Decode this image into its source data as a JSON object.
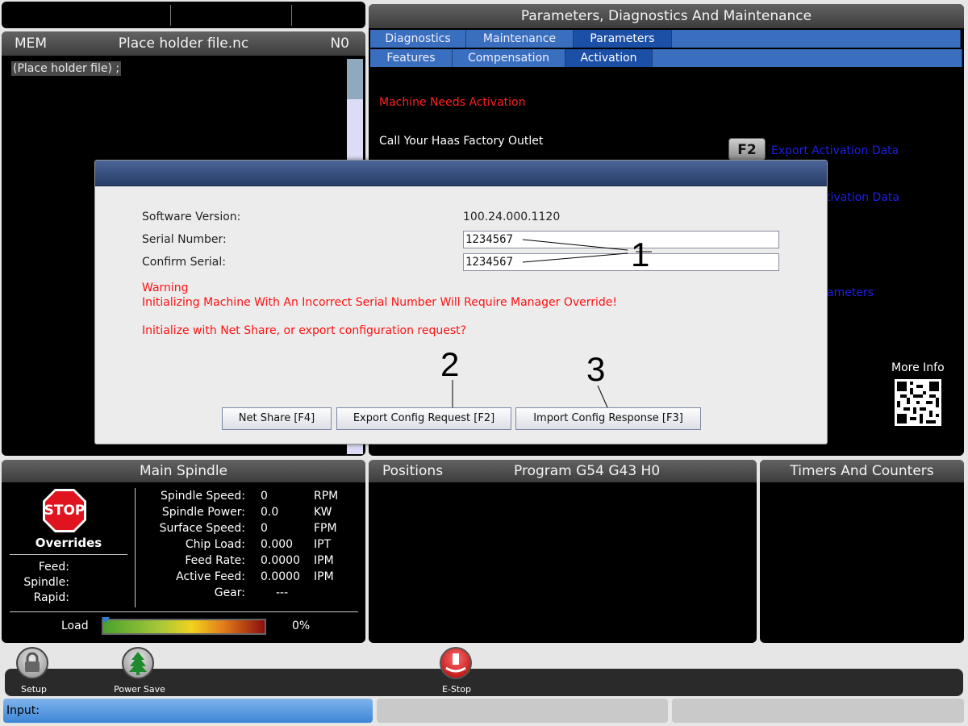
{
  "program": {
    "mode": "MEM",
    "filename": "Place holder file.nc",
    "line_no": "N0",
    "content_line": "(Place holder file) ;"
  },
  "pdm": {
    "title": "Parameters, Diagnostics And Maintenance",
    "tabs_row1": [
      "Diagnostics",
      "Maintenance",
      "Parameters"
    ],
    "tabs_row2": [
      "Features",
      "Compensation",
      "Activation"
    ],
    "machine_needs": "Machine Needs Activation",
    "call_outlet": "Call Your Haas Factory Outlet",
    "f2_key": "F2",
    "export_data": "Export Activation Data",
    "import_data_partial": "tivation Data",
    "parameters_partial": "ameters",
    "more_info": "More Info"
  },
  "dialog": {
    "software_label": "Software Version:",
    "software_value": "100.24.000.1120",
    "serial_label": "Serial Number:",
    "serial_value": "1234567",
    "confirm_label": "Confirm Serial:",
    "confirm_value": "1234567",
    "warning": "Warning",
    "warning_detail": "Initializing Machine With An Incorrect Serial Number Will Require Manager Override!",
    "question": "Initialize with Net Share, or export configuration request?",
    "btn_netshare": "Net Share [F4]",
    "btn_export": "Export Config Request [F2]",
    "btn_import": "Import Config Response [F3]"
  },
  "callouts": [
    "1",
    "2",
    "3"
  ],
  "spindle": {
    "title": "Main Spindle",
    "stop": "STOP",
    "overrides": "Overrides",
    "override_labels": [
      "Feed:",
      "Spindle:",
      "Rapid:"
    ],
    "rows": [
      {
        "label": "Spindle Speed:",
        "value": "0",
        "unit": "RPM"
      },
      {
        "label": "Spindle Power:",
        "value": "0.0",
        "unit": "KW"
      },
      {
        "label": "Surface Speed:",
        "value": "0",
        "unit": "FPM"
      },
      {
        "label": "Chip Load:",
        "value": "0.000",
        "unit": "IPT"
      },
      {
        "label": "Feed Rate:",
        "value": "0.0000",
        "unit": "IPM"
      },
      {
        "label": "Active Feed:",
        "value": "0.0000",
        "unit": "IPM"
      },
      {
        "label": "Gear:",
        "value": "---",
        "unit": ""
      }
    ],
    "load_label": "Load",
    "load_value": "0%",
    "load_fraction": 0.0
  },
  "positions": {
    "title": "Positions",
    "program": "Program G54 G43 H0"
  },
  "timers": {
    "title": "Timers And Counters"
  },
  "footer": {
    "setup": "Setup",
    "power_save": "Power Save",
    "estop": "E-Stop",
    "input_label": "Input:"
  },
  "colors": {
    "tab_blue": "#3a6fbf",
    "warning_red": "#ff1010",
    "link_blue": "#1e1ee6"
  }
}
